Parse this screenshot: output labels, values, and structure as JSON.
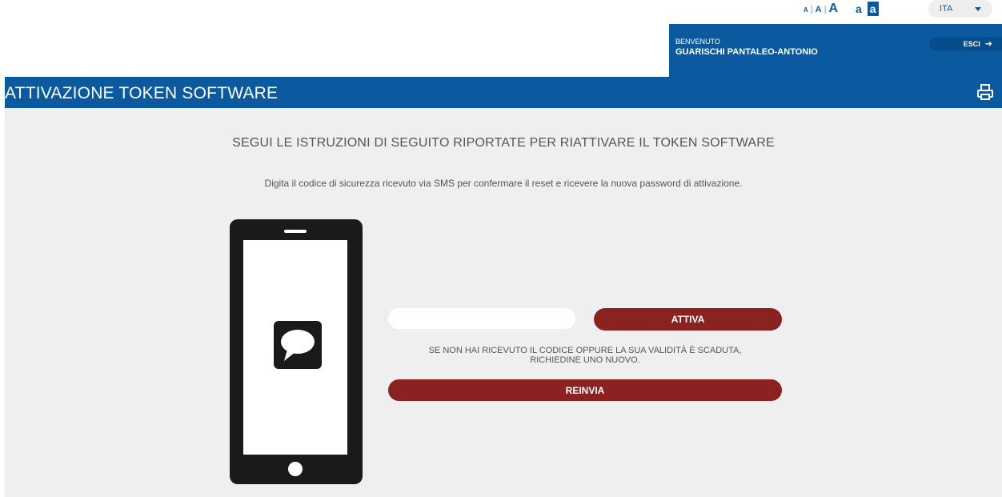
{
  "accessibility": {
    "font_sizes": [
      "A",
      "A",
      "A"
    ],
    "separator": "|",
    "contrast_normal": "a",
    "contrast_high": "a"
  },
  "language": {
    "selected": "ITA"
  },
  "user": {
    "welcome": "BENVENUTO",
    "name": "GUARISCHI PANTALEO-ANTONIO",
    "logout_label": "ESCI",
    "logout_icon": "arrow-right-icon"
  },
  "page": {
    "title": "ATTIVAZIONE TOKEN SOFTWARE",
    "print_icon": "print-icon"
  },
  "main": {
    "subtitle": "SEGUI LE ISTRUZIONI DI SEGUITO RIPORTATE PER RIATTIVARE IL TOKEN SOFTWARE",
    "instructions": "Digita il codice di sicurezza ricevuto via SMS per confermare il reset e ricevere la nuova password di attivazione.",
    "code_input_value": "",
    "activate_label": "ATTIVA",
    "resend_note_line1": "SE NON HAI RICEVUTO IL CODICE OPPURE LA SUA VALIDITÀ È SCADUTA,",
    "resend_note_line2": "RICHIEDINE UNO NUOVO.",
    "resend_label": "REINVIA"
  },
  "colors": {
    "brand_blue": "#0b5aa0",
    "button_red": "#8a2222",
    "content_bg": "#efefef"
  }
}
